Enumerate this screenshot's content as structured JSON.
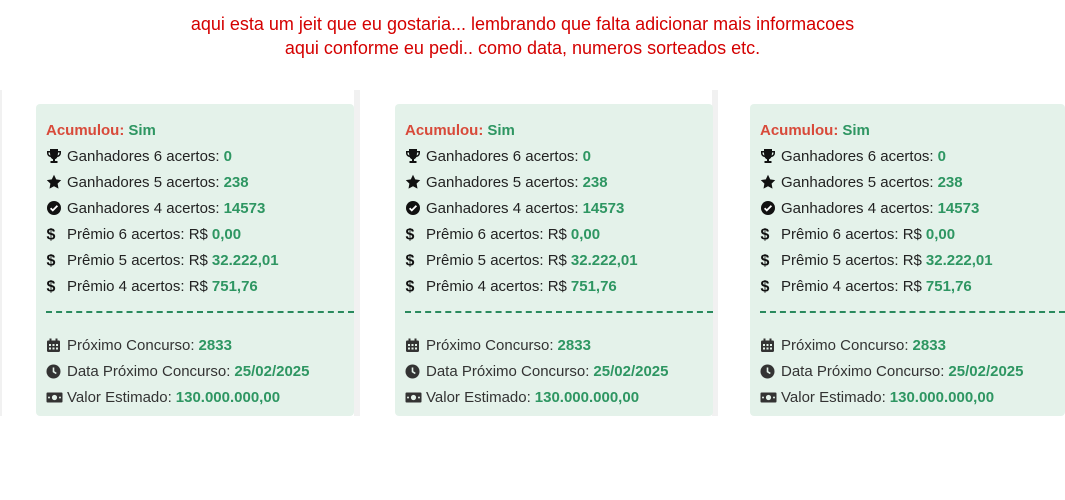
{
  "note": {
    "line1": "aqui esta um jeit que eu gostaria... lembrando que falta adicionar mais informacoes",
    "line2": "aqui conforme eu pedi.. como data, numeros sorteados etc."
  },
  "colors": {
    "accent_green": "#2e9662",
    "label_red": "#d84a3a",
    "card_bg": "#e4f2ea",
    "note_red": "#d40000"
  },
  "cards": [
    {
      "acumulou_label": "Acumulou:",
      "acumulou_value": "Sim",
      "stats": [
        {
          "icon": "trophy-icon",
          "label": "Ganhadores 6 acertos:",
          "value": "0"
        },
        {
          "icon": "star-icon",
          "label": "Ganhadores 5 acertos:",
          "value": "238"
        },
        {
          "icon": "check-circle-icon",
          "label": "Ganhadores 4 acertos:",
          "value": "14573"
        },
        {
          "icon": "dollar-icon",
          "label": "Prêmio 6 acertos: R$",
          "value": "0,00"
        },
        {
          "icon": "dollar-icon",
          "label": "Prêmio 5 acertos: R$",
          "value": "32.222,01"
        },
        {
          "icon": "dollar-icon",
          "label": "Prêmio 4 acertos: R$",
          "value": "751,76"
        }
      ],
      "next": [
        {
          "icon": "calendar-icon",
          "label": "Próximo Concurso:",
          "value": "2833"
        },
        {
          "icon": "clock-icon",
          "label": "Data Próximo Concurso:",
          "value": "25/02/2025"
        },
        {
          "icon": "money-bill-icon",
          "label": "Valor Estimado:",
          "value": "130.000.000,00"
        }
      ]
    },
    {
      "acumulou_label": "Acumulou:",
      "acumulou_value": "Sim",
      "stats": [
        {
          "icon": "trophy-icon",
          "label": "Ganhadores 6 acertos:",
          "value": "0"
        },
        {
          "icon": "star-icon",
          "label": "Ganhadores 5 acertos:",
          "value": "238"
        },
        {
          "icon": "check-circle-icon",
          "label": "Ganhadores 4 acertos:",
          "value": "14573"
        },
        {
          "icon": "dollar-icon",
          "label": "Prêmio 6 acertos: R$",
          "value": "0,00"
        },
        {
          "icon": "dollar-icon",
          "label": "Prêmio 5 acertos: R$",
          "value": "32.222,01"
        },
        {
          "icon": "dollar-icon",
          "label": "Prêmio 4 acertos: R$",
          "value": "751,76"
        }
      ],
      "next": [
        {
          "icon": "calendar-icon",
          "label": "Próximo Concurso:",
          "value": "2833"
        },
        {
          "icon": "clock-icon",
          "label": "Data Próximo Concurso:",
          "value": "25/02/2025"
        },
        {
          "icon": "money-bill-icon",
          "label": "Valor Estimado:",
          "value": "130.000.000,00"
        }
      ]
    },
    {
      "acumulou_label": "Acumulou:",
      "acumulou_value": "Sim",
      "stats": [
        {
          "icon": "trophy-icon",
          "label": "Ganhadores 6 acertos:",
          "value": "0"
        },
        {
          "icon": "star-icon",
          "label": "Ganhadores 5 acertos:",
          "value": "238"
        },
        {
          "icon": "check-circle-icon",
          "label": "Ganhadores 4 acertos:",
          "value": "14573"
        },
        {
          "icon": "dollar-icon",
          "label": "Prêmio 6 acertos: R$",
          "value": "0,00"
        },
        {
          "icon": "dollar-icon",
          "label": "Prêmio 5 acertos: R$",
          "value": "32.222,01"
        },
        {
          "icon": "dollar-icon",
          "label": "Prêmio 4 acertos: R$",
          "value": "751,76"
        }
      ],
      "next": [
        {
          "icon": "calendar-icon",
          "label": "Próximo Concurso:",
          "value": "2833"
        },
        {
          "icon": "clock-icon",
          "label": "Data Próximo Concurso:",
          "value": "25/02/2025"
        },
        {
          "icon": "money-bill-icon",
          "label": "Valor Estimado:",
          "value": "130.000.000,00"
        }
      ]
    }
  ]
}
